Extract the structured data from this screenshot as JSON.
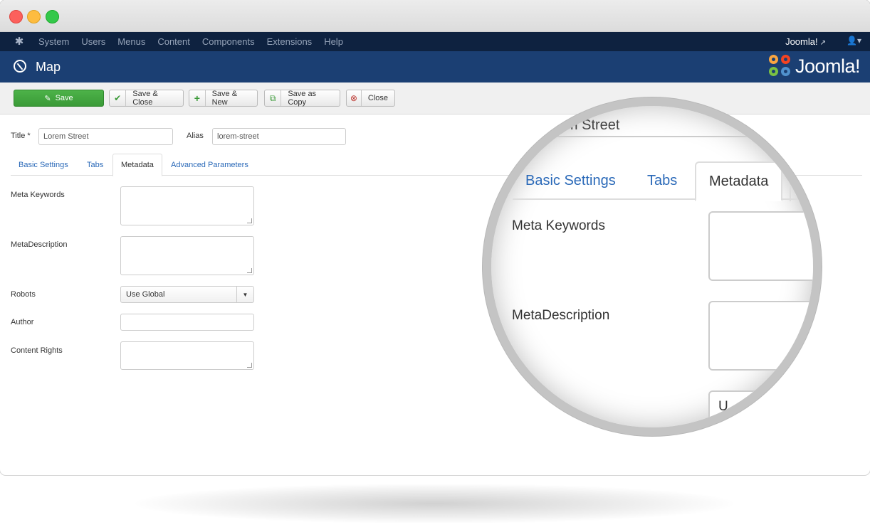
{
  "window": {
    "title": ""
  },
  "navbar": {
    "menu": [
      "System",
      "Users",
      "Menus",
      "Content",
      "Components",
      "Extensions",
      "Help"
    ],
    "site_link": "Joomla!"
  },
  "header": {
    "title": "Map",
    "brand": "Joomla!"
  },
  "toolbar": {
    "save": "Save",
    "save_close": "Save & Close",
    "save_new": "Save & New",
    "save_copy": "Save as Copy",
    "close": "Close"
  },
  "form": {
    "title_label": "Title *",
    "title_value": "Lorem Street",
    "alias_label": "Alias",
    "alias_value": "lorem-street"
  },
  "tabs": [
    "Basic Settings",
    "Tabs",
    "Metadata",
    "Advanced Parameters"
  ],
  "active_tab": "Metadata",
  "metadata": {
    "meta_keywords_label": "Meta Keywords",
    "meta_description_label": "MetaDescription",
    "robots_label": "Robots",
    "robots_value": "Use Global",
    "author_label": "Author",
    "content_rights_label": "Content Rights"
  },
  "magnifier": {
    "title_fragment": "orem Street",
    "tabs": [
      "Basic Settings",
      "Tabs",
      "Metadata"
    ],
    "meta_keywords_label": "Meta Keywords",
    "meta_description_label": "MetaDescription",
    "select_fragment": "U"
  },
  "colors": {
    "navbar": "#0e2240",
    "header": "#1b3f73",
    "save_button": "#46a546",
    "link": "#2a69b8"
  }
}
